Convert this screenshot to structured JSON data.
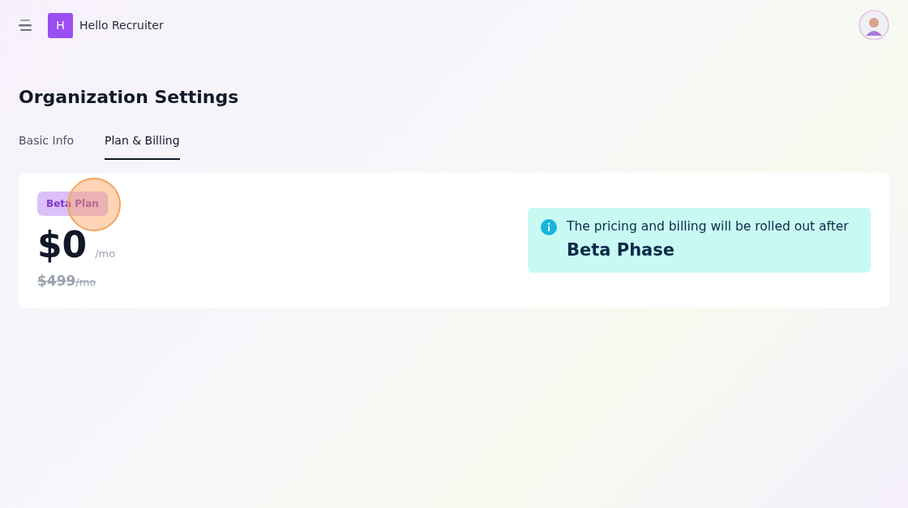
{
  "header": {
    "logo_letter": "H",
    "app_name": "Hello Recruiter"
  },
  "page_title": "Organization Settings",
  "tabs": [
    {
      "label": "Basic Info",
      "selected": false
    },
    {
      "label": "Plan & Billing",
      "selected": true
    }
  ],
  "plan": {
    "badge": "Beta Plan",
    "price": "$0",
    "period": "/mo",
    "old_price": "$499",
    "old_period": "/mo"
  },
  "notice": {
    "text": "The pricing and billing will be rolled out after",
    "emphasis": "Beta Phase"
  }
}
